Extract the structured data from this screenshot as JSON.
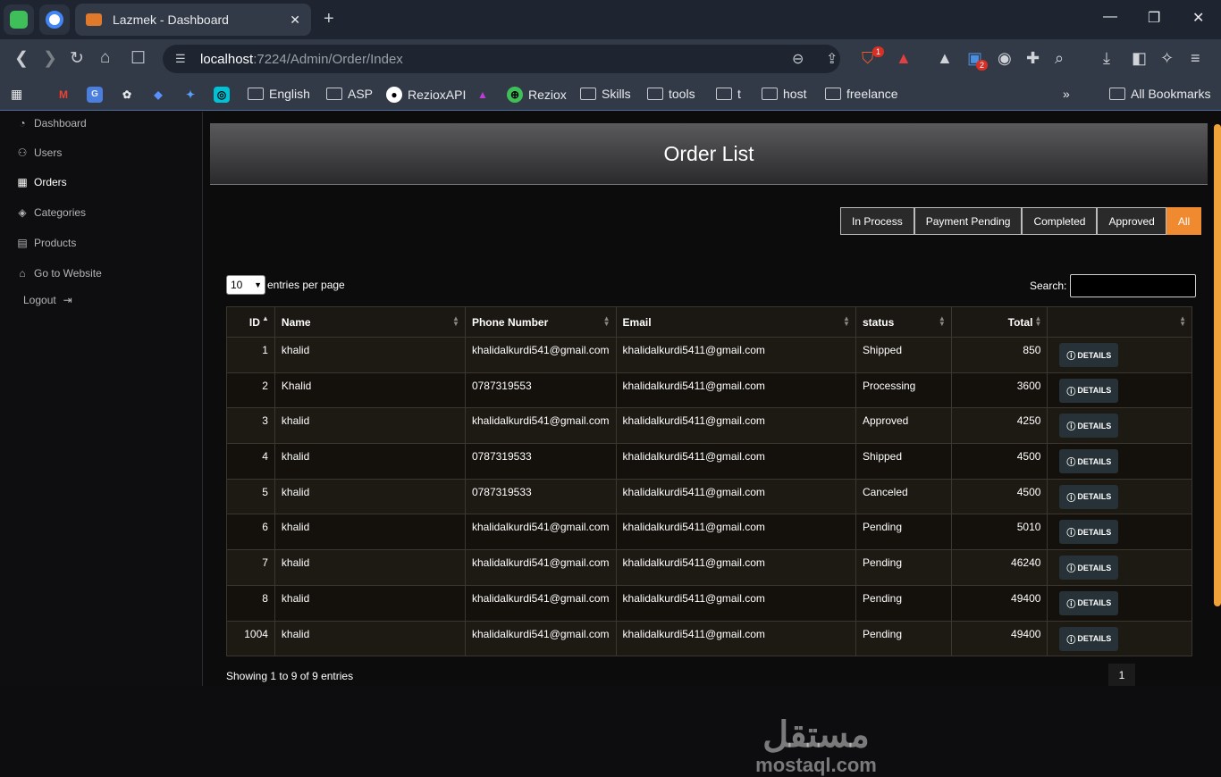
{
  "browser": {
    "tab_title": "Lazmek - Dashboard",
    "url_host": "localhost",
    "url_path": ":7224/Admin/Order/Index",
    "extension_badge": "2",
    "brave_badge": "1",
    "bookmarks": [
      "English",
      "ASP",
      "RezioxAPI",
      "Reziox",
      "Skills",
      "tools",
      "t",
      "host",
      "freelance"
    ],
    "all_bookmarks": "All Bookmarks"
  },
  "sidebar": {
    "items": [
      {
        "label": "Dashboard",
        "icon": "gauge-icon"
      },
      {
        "label": "Users",
        "icon": "users-icon"
      },
      {
        "label": "Orders",
        "icon": "table-icon"
      },
      {
        "label": "Categories",
        "icon": "tags-icon"
      },
      {
        "label": "Products",
        "icon": "box-icon"
      },
      {
        "label": "Go to Website",
        "icon": "home-icon"
      }
    ],
    "logout": "Logout"
  },
  "page": {
    "title": "Order List",
    "filters": [
      "In Process",
      "Payment Pending",
      "Completed",
      "Approved",
      "All"
    ],
    "active_filter": "All",
    "length_value": "10",
    "length_label": "entries per page",
    "search_label": "Search:",
    "columns": [
      "ID",
      "Name",
      "Phone Number",
      "Email",
      "status",
      "Total",
      ""
    ],
    "details_label": "DETAILS",
    "rows": [
      {
        "id": "1",
        "name": "khalid",
        "phone": "khalidalkurdi541@gmail.com",
        "email": "khalidalkurdi5411@gmail.com",
        "status": "Shipped",
        "total": "850"
      },
      {
        "id": "2",
        "name": "Khalid",
        "phone": "0787319553",
        "email": "khalidalkurdi5411@gmail.com",
        "status": "Processing",
        "total": "3600"
      },
      {
        "id": "3",
        "name": "khalid",
        "phone": "khalidalkurdi541@gmail.com",
        "email": "khalidalkurdi5411@gmail.com",
        "status": "Approved",
        "total": "4250"
      },
      {
        "id": "4",
        "name": "khalid",
        "phone": "0787319533",
        "email": "khalidalkurdi5411@gmail.com",
        "status": "Shipped",
        "total": "4500"
      },
      {
        "id": "5",
        "name": "khalid",
        "phone": "0787319533",
        "email": "khalidalkurdi5411@gmail.com",
        "status": "Canceled",
        "total": "4500"
      },
      {
        "id": "6",
        "name": "khalid",
        "phone": "khalidalkurdi541@gmail.com",
        "email": "khalidalkurdi5411@gmail.com",
        "status": "Pending",
        "total": "5010"
      },
      {
        "id": "7",
        "name": "khalid",
        "phone": "khalidalkurdi541@gmail.com",
        "email": "khalidalkurdi5411@gmail.com",
        "status": "Pending",
        "total": "46240"
      },
      {
        "id": "8",
        "name": "khalid",
        "phone": "khalidalkurdi541@gmail.com",
        "email": "khalidalkurdi5411@gmail.com",
        "status": "Pending",
        "total": "49400"
      },
      {
        "id": "1004",
        "name": "khalid",
        "phone": "khalidalkurdi541@gmail.com",
        "email": "khalidalkurdi5411@gmail.com",
        "status": "Pending",
        "total": "49400"
      }
    ],
    "info": "Showing 1 to 9 of 9 entries",
    "current_page": "1"
  },
  "watermark": {
    "arabic": "مستقل",
    "latin": "mostaql.com"
  },
  "colors": {
    "accent": "#f08a30",
    "header_gradient_top": "#5a5a5c",
    "details_button": "#263237"
  }
}
